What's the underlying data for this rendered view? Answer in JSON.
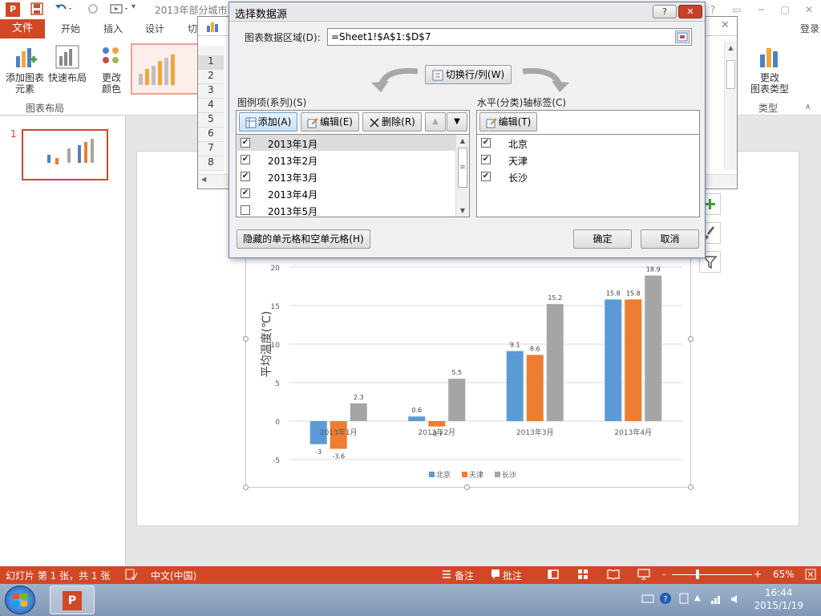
{
  "window": {
    "title": "2013年部分城市",
    "controls": [
      "?",
      "▭",
      "─",
      "▢",
      "✕"
    ]
  },
  "ribbon": {
    "tabs": {
      "file": "文件",
      "home": "开始",
      "insert": "插入",
      "design": "设计",
      "transitions": "切"
    },
    "login": "登录",
    "buttons": {
      "add_element": "添加图表\n元素",
      "quick_layout": "快速布局",
      "change_color": "更改\n颜色",
      "change_type": "更改\n图表类型"
    },
    "groups": {
      "layout": "图表布局",
      "type": "类型"
    }
  },
  "thumbnails": {
    "slide_number": "1"
  },
  "excel": {
    "rows": [
      "1",
      "2",
      "3",
      "4",
      "5",
      "6",
      "7",
      "8"
    ],
    "close": "✕"
  },
  "dialog": {
    "title": "选择数据源",
    "range_label": "图表数据区域(D):",
    "range_value": "=Sheet1!$A$1:$D$7",
    "switch_button": "切换行/列(W)",
    "legend_header": "图例项(系列)(S)",
    "axis_header": "水平(分类)轴标签(C)",
    "add_button": "添加(A)",
    "edit_button": "编辑(E)",
    "delete_button": "删除(R)",
    "axis_edit_button": "编辑(T)",
    "series": [
      {
        "label": "2013年1月",
        "checked": true
      },
      {
        "label": "2013年2月",
        "checked": true
      },
      {
        "label": "2013年3月",
        "checked": true
      },
      {
        "label": "2013年4月",
        "checked": true
      },
      {
        "label": "2013年5月",
        "checked": false
      }
    ],
    "axis_labels": [
      {
        "label": "北京",
        "checked": true
      },
      {
        "label": "天津",
        "checked": true
      },
      {
        "label": "长沙",
        "checked": true
      }
    ],
    "hidden_cells_button": "隐藏的单元格和空单元格(H)",
    "ok_button": "确定",
    "cancel_button": "取消"
  },
  "chart_data": {
    "type": "bar",
    "categories": [
      "2013年1月",
      "2013年2月",
      "2013年3月",
      "2013年4月"
    ],
    "series": [
      {
        "name": "北京",
        "color": "#5b9bd5",
        "values": [
          -3,
          0.6,
          9.1,
          15.8
        ]
      },
      {
        "name": "天津",
        "color": "#ed7d31",
        "values": [
          -3.6,
          -0.7,
          8.6,
          15.8
        ]
      },
      {
        "name": "长沙",
        "color": "#a5a5a5",
        "values": [
          2.3,
          5.5,
          15.2,
          18.9
        ]
      }
    ],
    "data_labels": [
      [
        "-3",
        "0.6",
        "9.1",
        "15.8"
      ],
      [
        "-3.6",
        "-0.7",
        "8.6",
        "15.8"
      ],
      [
        "2.3",
        "5.5",
        "15.2",
        "18.9"
      ]
    ],
    "ylabel": "平均温度(℃)",
    "ylim": [
      -5,
      20
    ],
    "yticks": [
      "20",
      "15",
      "10",
      "5",
      "0",
      "-5"
    ],
    "grid": true,
    "legend": "bottom"
  },
  "statusbar": {
    "slide_info": "幻灯片 第 1 张，共 1 张",
    "language": "中文(中国)",
    "notes": "备注",
    "comments": "批注",
    "zoom_minus": "-",
    "zoom_plus": "+",
    "zoom": "65%"
  },
  "taskbar": {
    "time": "16:44",
    "date": "2015/1/19"
  }
}
